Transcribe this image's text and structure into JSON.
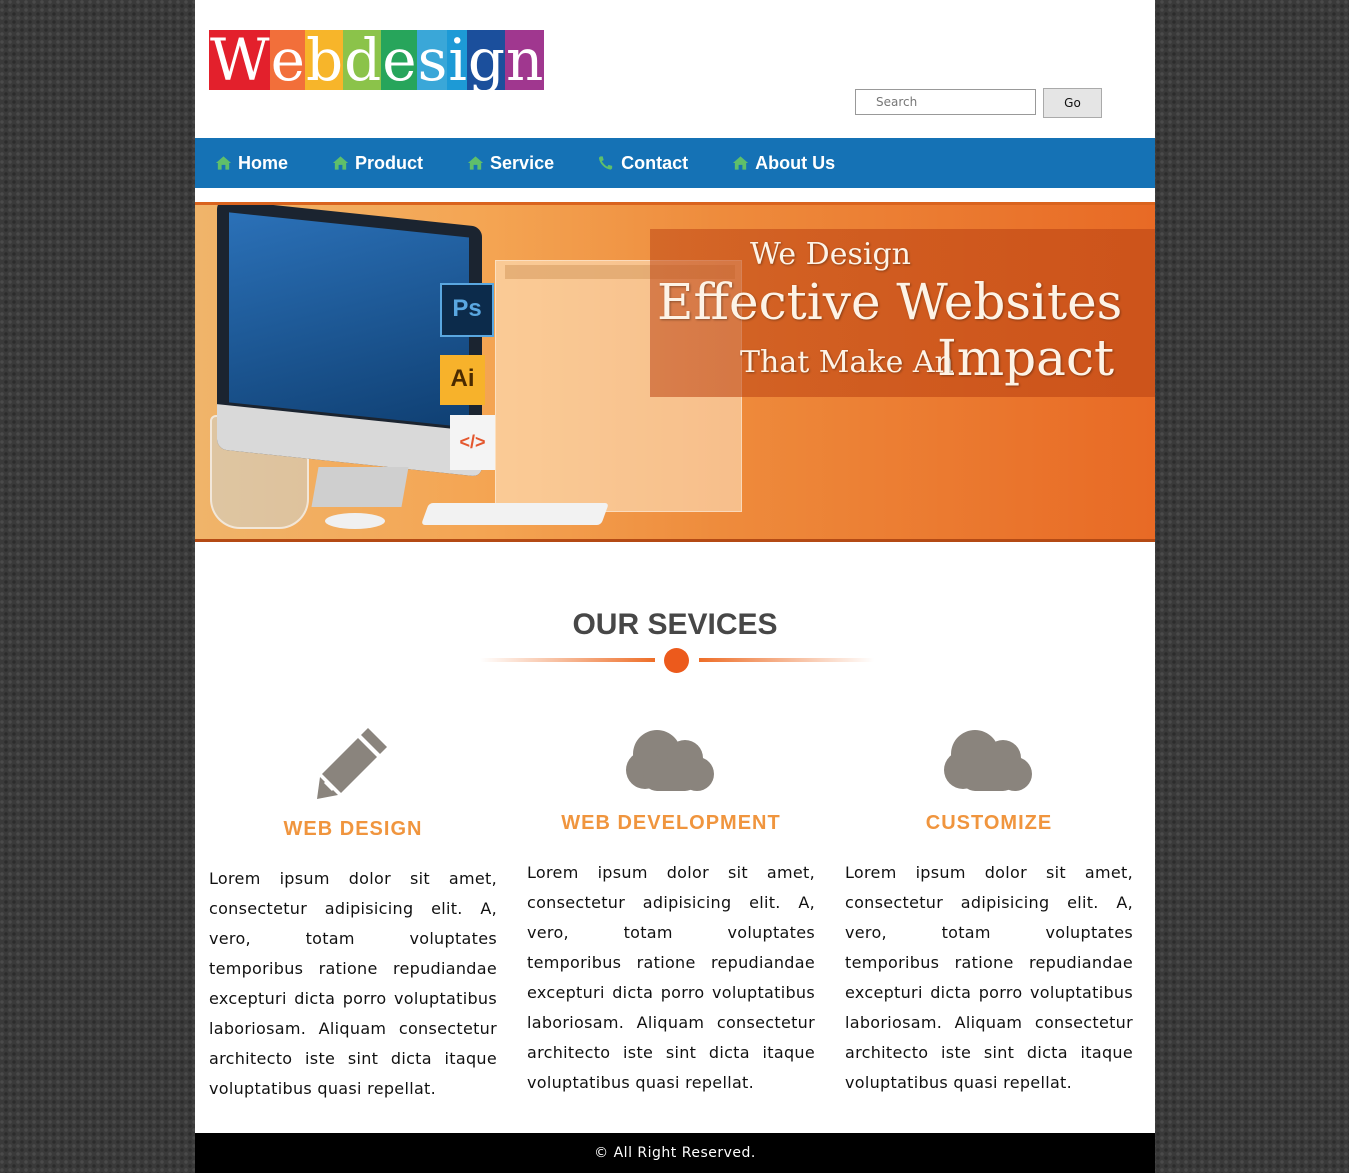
{
  "logo": {
    "letters": [
      "W",
      "e",
      "b",
      "d",
      "e",
      "s",
      "i",
      "g",
      "n"
    ],
    "colors": [
      "#e3202c",
      "#f26f3a",
      "#f7b52a",
      "#8bc34a",
      "#27a55b",
      "#3aa7d8",
      "#1d9ad6",
      "#1b4f9c",
      "#a0378f"
    ]
  },
  "search": {
    "placeholder": "Search",
    "button_label": "Go"
  },
  "nav": {
    "items": [
      {
        "label": "Home",
        "icon": "home-icon"
      },
      {
        "label": "Product",
        "icon": "home-icon"
      },
      {
        "label": "Service",
        "icon": "home-icon"
      },
      {
        "label": "Contact",
        "icon": "phone-icon"
      },
      {
        "label": "About Us",
        "icon": "home-icon"
      }
    ],
    "background": "#1572b5",
    "icon_color": "#5fbf6a"
  },
  "banner": {
    "line1": "We Design",
    "line2": "Effective Websites",
    "line3": "That Make An",
    "line4": "Impact",
    "badge_ps": "Ps",
    "badge_ai": "Ai",
    "badge_code": "</>"
  },
  "services": {
    "title": "OUR SEVICES",
    "accent": "#ec5a1c",
    "items": [
      {
        "icon": "pencil-icon",
        "title": "WEB DESIGN",
        "text": "Lorem ipsum dolor sit amet, consectetur adipisicing elit. A, vero, totam voluptates temporibus ratione repudiandae excepturi dicta porro voluptatibus laboriosam. Aliquam consectetur architecto iste sint dicta itaque voluptatibus quasi repellat."
      },
      {
        "icon": "cloud-icon",
        "title": "WEB DEVELOPMENT",
        "text": "Lorem ipsum dolor sit amet, consectetur adipisicing elit. A, vero, totam voluptates temporibus ratione repudiandae excepturi dicta porro voluptatibus laboriosam. Aliquam consectetur architecto iste sint dicta itaque voluptatibus quasi repellat."
      },
      {
        "icon": "cloud-icon",
        "title": "CUSTOMIZE",
        "text": "Lorem ipsum dolor sit amet, consectetur adipisicing elit. A, vero, totam voluptates temporibus ratione repudiandae excepturi dicta porro voluptatibus laboriosam. Aliquam consectetur architecto iste sint dicta itaque voluptatibus quasi repellat."
      }
    ]
  },
  "footer": {
    "text": "© All Right Reserved."
  }
}
